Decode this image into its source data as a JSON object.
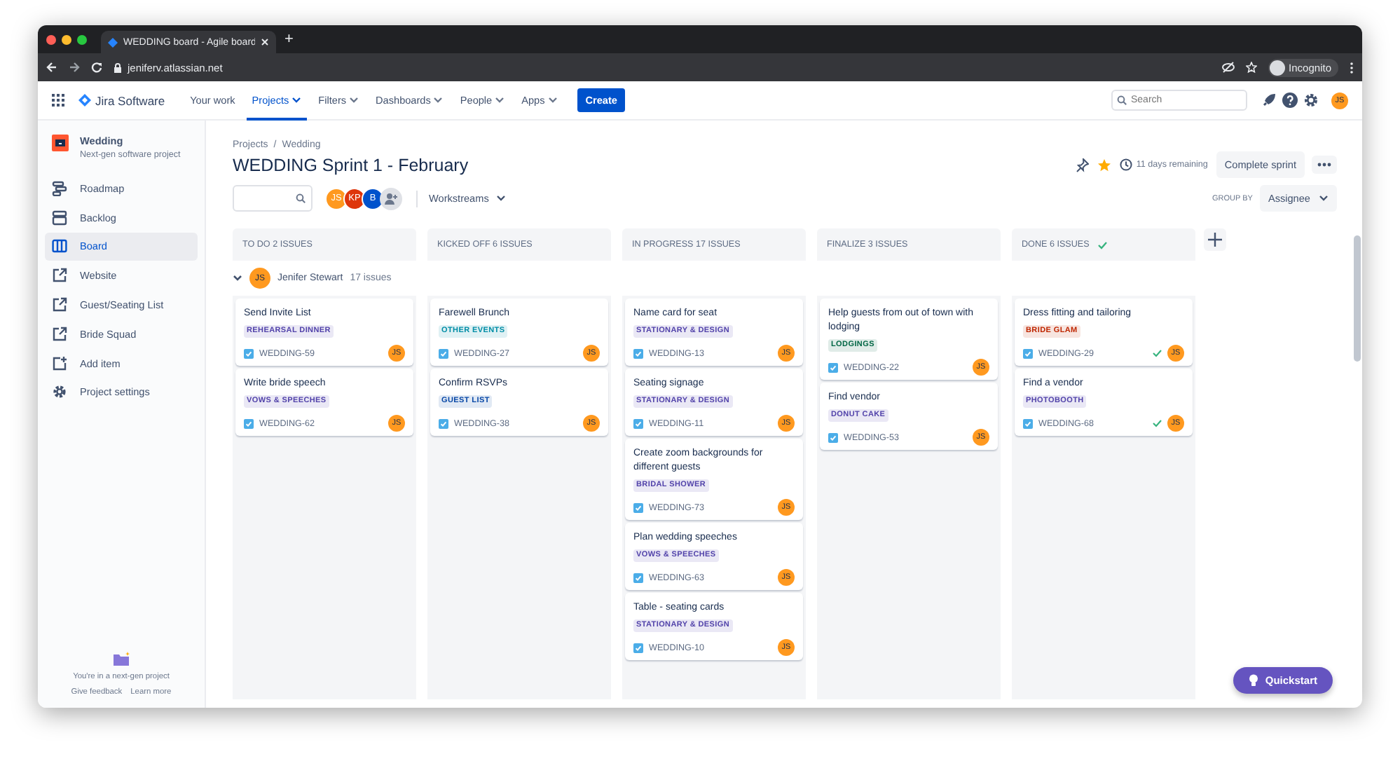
{
  "browser": {
    "tab_title": "WEDDING board - Agile board",
    "new_tab": "+",
    "address": "jeniferv.atlassian.net",
    "profile": "Incognito"
  },
  "nav": {
    "product": "Jira Software",
    "items": [
      {
        "label": "Your work",
        "selected": false,
        "menu": false
      },
      {
        "label": "Projects",
        "selected": true,
        "menu": true
      },
      {
        "label": "Filters",
        "selected": false,
        "menu": true
      },
      {
        "label": "Dashboards",
        "selected": false,
        "menu": true
      },
      {
        "label": "People",
        "selected": false,
        "menu": true
      },
      {
        "label": "Apps",
        "selected": false,
        "menu": true
      }
    ],
    "create": "Create",
    "search": {
      "placeholder": "Search"
    },
    "user_initials": "JS"
  },
  "sidebar": {
    "project": {
      "name": "Wedding",
      "type": "Next-gen software project"
    },
    "items": [
      {
        "label": "Roadmap",
        "selected": false
      },
      {
        "label": "Backlog",
        "selected": false
      },
      {
        "label": "Board",
        "selected": true
      },
      {
        "label": "Website",
        "selected": false
      },
      {
        "label": "Guest/Seating List",
        "selected": false
      },
      {
        "label": "Bride Squad",
        "selected": false
      },
      {
        "label": "Add item",
        "selected": false
      },
      {
        "label": "Project settings",
        "selected": false
      }
    ],
    "footer": {
      "text": "You're in a next-gen project",
      "links": [
        "Give feedback",
        "Learn more"
      ]
    }
  },
  "header": {
    "breadcrumbs": [
      "Projects",
      "Wedding"
    ],
    "separator": "/",
    "title": "WEDDING Sprint 1 - February",
    "starred": true,
    "remaining": "11 days remaining",
    "complete": "Complete sprint",
    "avatars": [
      {
        "initials": "JS",
        "color": "#ff991f"
      },
      {
        "initials": "KP",
        "color": "#de350b"
      },
      {
        "initials": "B",
        "color": "#0052cc"
      }
    ],
    "filter": "Workstreams",
    "group_by_label": "GROUP BY",
    "group_by": "Assignee"
  },
  "board": {
    "columns": [
      {
        "title": "TO DO 2 ISSUES",
        "done": false,
        "cards": [
          {
            "title": "Send Invite List",
            "label": {
              "text": "REHEARSAL DINNER",
              "color": "#5243aa"
            },
            "key": "WEDDING-59",
            "done": false,
            "assignee": "JS"
          },
          {
            "title": "Write bride speech",
            "label": {
              "text": "VOWS & SPEECHES",
              "color": "#5243aa"
            },
            "key": "WEDDING-62",
            "done": false,
            "assignee": "JS"
          }
        ]
      },
      {
        "title": "KICKED OFF 6 ISSUES",
        "done": false,
        "cards": [
          {
            "title": "Farewell Brunch",
            "label": {
              "text": "OTHER EVENTS",
              "color": "#008da6"
            },
            "key": "WEDDING-27",
            "done": false,
            "assignee": "JS"
          },
          {
            "title": "Confirm RSVPs",
            "label": {
              "text": "GUEST LIST",
              "color": "#0747a6"
            },
            "key": "WEDDING-38",
            "done": false,
            "assignee": "JS"
          }
        ]
      },
      {
        "title": "IN PROGRESS 17 ISSUES",
        "done": false,
        "cards": [
          {
            "title": "Name card for seat",
            "label": {
              "text": "STATIONARY & DESIGN",
              "color": "#5243aa"
            },
            "key": "WEDDING-13",
            "done": false,
            "assignee": "JS"
          },
          {
            "title": "Seating signage",
            "label": {
              "text": "STATIONARY & DESIGN",
              "color": "#5243aa"
            },
            "key": "WEDDING-11",
            "done": false,
            "assignee": "JS"
          },
          {
            "title": "Create zoom backgrounds for different guests",
            "label": {
              "text": "BRIDAL SHOWER",
              "color": "#5243aa"
            },
            "key": "WEDDING-73",
            "done": false,
            "assignee": "JS"
          },
          {
            "title": "Plan wedding speeches",
            "label": {
              "text": "VOWS & SPEECHES",
              "color": "#5243aa"
            },
            "key": "WEDDING-63",
            "done": false,
            "assignee": "JS"
          },
          {
            "title": "Table - seating cards",
            "label": {
              "text": "STATIONARY & DESIGN",
              "color": "#5243aa"
            },
            "key": "WEDDING-10",
            "done": false,
            "assignee": "JS"
          }
        ]
      },
      {
        "title": "FINALIZE 3 ISSUES",
        "done": false,
        "cards": [
          {
            "title": "Help guests from out of town with lodging",
            "label": {
              "text": "LODGINGS",
              "color": "#006644"
            },
            "key": "WEDDING-22",
            "done": false,
            "assignee": "JS"
          },
          {
            "title": "Find vendor",
            "label": {
              "text": "DONUT CAKE",
              "color": "#5243aa"
            },
            "key": "WEDDING-53",
            "done": false,
            "assignee": "JS"
          }
        ]
      },
      {
        "title": "DONE 6 ISSUES",
        "done": true,
        "cards": [
          {
            "title": "Dress fitting and tailoring",
            "label": {
              "text": "BRIDE GLAM",
              "color": "#bf2600"
            },
            "key": "WEDDING-29",
            "done": true,
            "assignee": "JS"
          },
          {
            "title": "Find a vendor",
            "label": {
              "text": "PHOTOBOOTH",
              "color": "#5243aa"
            },
            "key": "WEDDING-68",
            "done": true,
            "assignee": "JS"
          }
        ]
      }
    ],
    "swimlane": {
      "initials": "JS",
      "name": "Jenifer Stewart",
      "count": "17 issues",
      "expanded": true
    }
  },
  "quickstart": "Quickstart"
}
